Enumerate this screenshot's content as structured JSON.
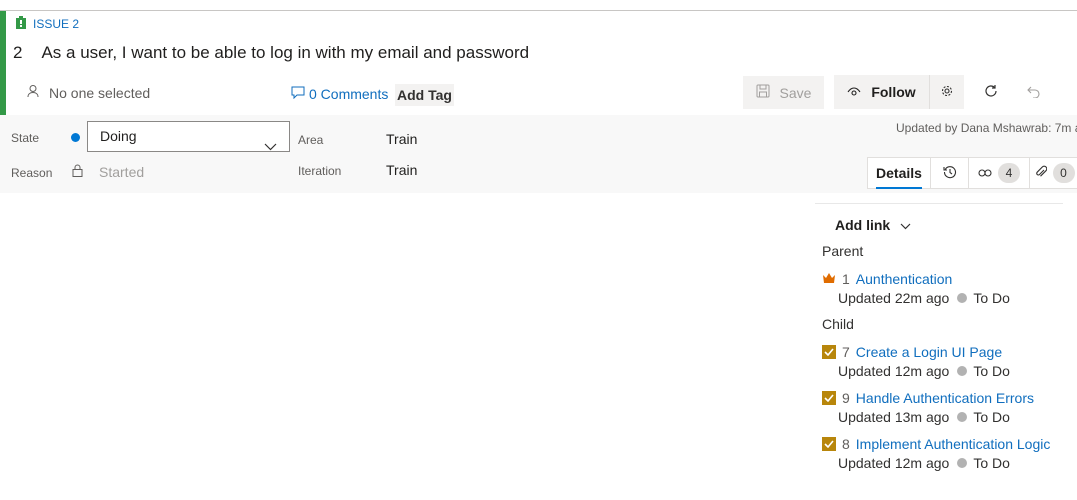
{
  "work_item": {
    "type_label": "ISSUE 2",
    "id": "2",
    "title": "As a user, I want to be able to log in with my email and password",
    "assignee": "No one selected",
    "comments": "0 Comments",
    "add_tag": "Add Tag"
  },
  "toolbar": {
    "save_label": "Save",
    "follow_label": "Follow"
  },
  "fields": {
    "state_label": "State",
    "state_value": "Doing",
    "reason_label": "Reason",
    "reason_value": "Started",
    "area_label": "Area",
    "area_value": "Train",
    "iteration_label": "Iteration",
    "iteration_value": "Train"
  },
  "updated_by": "Updated by Dana Mshawrab: 7m a",
  "tabs": {
    "details": "Details",
    "links_count": "4",
    "attachments_count": "0"
  },
  "links": {
    "add_link": "Add link",
    "parent_label": "Parent",
    "child_label": "Child",
    "parent": {
      "id": "1",
      "title": "Aunthentication",
      "updated": "Updated 22m ago",
      "state": "To Do"
    },
    "children": [
      {
        "id": "7",
        "title": "Create a Login UI Page",
        "updated": "Updated 12m ago",
        "state": "To Do"
      },
      {
        "id": "9",
        "title": "Handle Authentication Errors",
        "updated": "Updated 13m ago",
        "state": "To Do"
      },
      {
        "id": "8",
        "title": "Implement Authentication Logic",
        "updated": "Updated 12m ago",
        "state": "To Do"
      }
    ]
  },
  "colors": {
    "issue_accent": "#339947",
    "state_doing": "#0078d4",
    "link_blue": "#106ebe",
    "task_check": "#b8860b",
    "epic_crown": "#e06c00",
    "todo_dot": "#b2b2b2"
  },
  "icons": {
    "type": "issue-icon",
    "assignee": "person-icon",
    "comments": "comment-icon",
    "save": "save-icon",
    "follow": "eye-icon",
    "settings": "gear-icon",
    "refresh": "refresh-icon",
    "undo": "undo-icon",
    "reason_lock": "lock-icon",
    "history": "history-icon",
    "links": "link-icon",
    "attachments": "paperclip-icon",
    "parent_type": "crown-icon",
    "child_type": "check-icon"
  }
}
